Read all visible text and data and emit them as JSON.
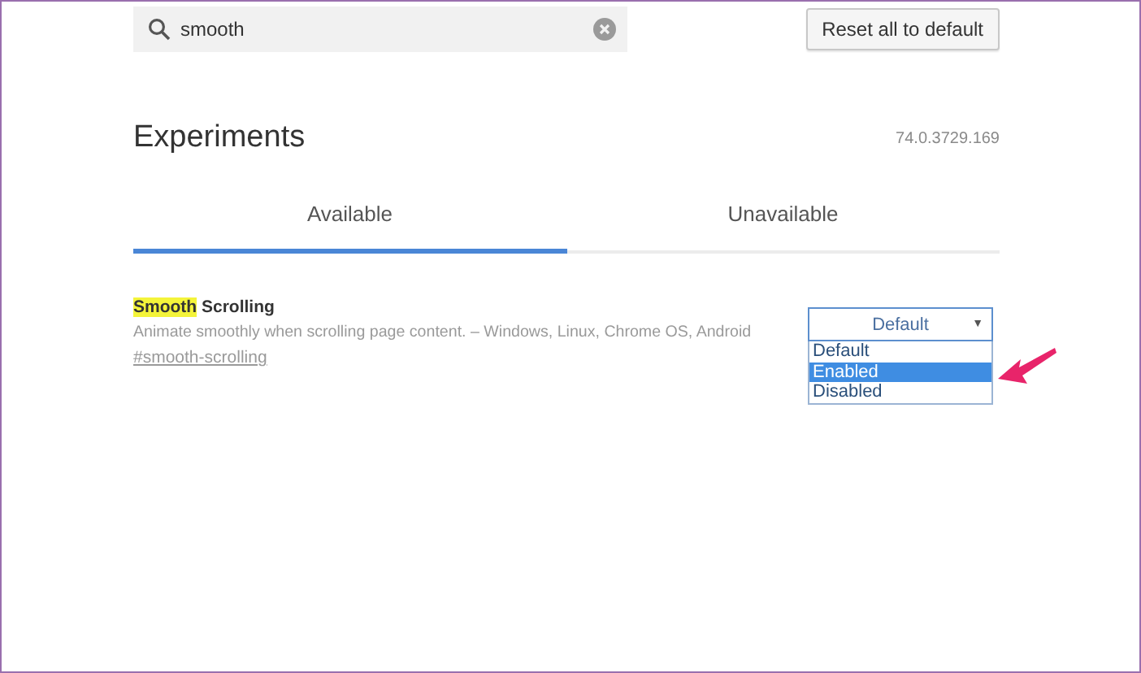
{
  "search": {
    "value": "smooth"
  },
  "reset_button": "Reset all to default",
  "title": "Experiments",
  "version": "74.0.3729.169",
  "tabs": [
    {
      "label": "Available",
      "selected": true
    },
    {
      "label": "Unavailable",
      "selected": false
    }
  ],
  "experiments": [
    {
      "name_parts": [
        {
          "text": "Smooth",
          "highlighted": true
        },
        {
          "text": " Scrolling",
          "highlighted": false
        }
      ],
      "description": "Animate smoothly when scrolling page content. – Windows, Linux, Chrome OS, Android",
      "link": "#smooth-scrolling",
      "dropdown": {
        "value": "Default",
        "arrow": "▼",
        "expanded": true,
        "options": [
          {
            "label": "Default",
            "highlighted": false
          },
          {
            "label": "Enabled",
            "highlighted": true
          },
          {
            "label": "Disabled",
            "highlighted": false
          }
        ]
      }
    }
  ]
}
